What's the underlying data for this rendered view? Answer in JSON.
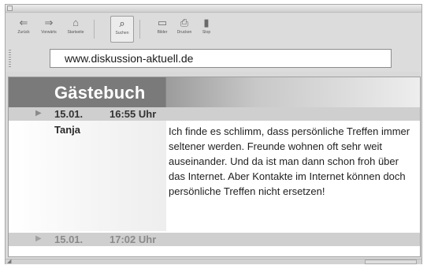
{
  "toolbar": {
    "buttons": [
      {
        "label": "Zurück",
        "icon": "back-arrow-icon",
        "glyph": "⇐"
      },
      {
        "label": "Vorwärts",
        "icon": "forward-arrow-icon",
        "glyph": "⇒"
      },
      {
        "label": "Startseite",
        "icon": "home-icon",
        "glyph": "⌂"
      },
      {
        "label": "Suchen",
        "icon": "search-icon",
        "glyph": "⌕"
      },
      {
        "label": "Bilder",
        "icon": "images-icon",
        "glyph": "▭"
      },
      {
        "label": "Drucken",
        "icon": "print-icon",
        "glyph": "⎙"
      },
      {
        "label": "Stop",
        "icon": "stop-icon",
        "glyph": "▮"
      }
    ]
  },
  "address": {
    "url": "www.diskussion-aktuell.de"
  },
  "guestbook": {
    "title": "Gästebuch",
    "entries": [
      {
        "date": "15.01.",
        "time": "16:55 Uhr",
        "author": "Tanja",
        "message": "Ich finde es schlimm, dass persönliche Treffen immer seltener werden. Freunde wohnen oft sehr weit auseinander. Und da ist man dann schon froh über das Internet. Aber Kontakte im Internet können doch persönliche Treffen nicht ersetzen!"
      },
      {
        "date": "15.01.",
        "time": "17:02 Uhr"
      }
    ]
  },
  "colors": {
    "header_dark": "#7a7a7a",
    "entry_bar": "#cfcfcf",
    "chrome": "#dcdcdc"
  }
}
